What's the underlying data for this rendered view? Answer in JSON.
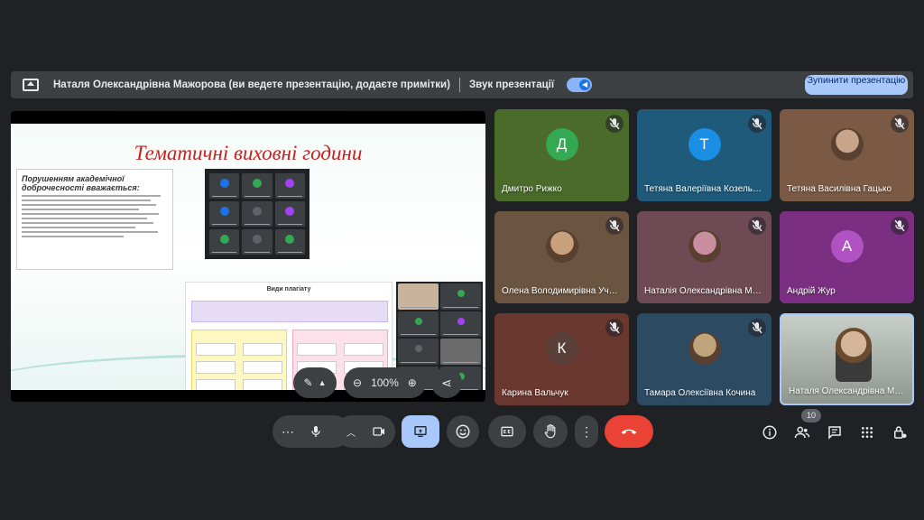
{
  "topbar": {
    "presenter_text": "Наталя Олександрівна Мажорова (ви ведете презентацію, додаєте примітки)",
    "sound_label": "Звук презентації",
    "stop_button": "Зупинити презентацію"
  },
  "slide": {
    "title": "Тематичні виховні години",
    "card_heading": "Порушенням академічної доброчесності вважається:",
    "plagiarism_title": "Види плагіату"
  },
  "zoom": {
    "level": "100%"
  },
  "participants": [
    {
      "name": "Дмитро Рижко",
      "initial": "Д",
      "bg": "#4a6b2a",
      "avatar_color": "#34a853",
      "muted": true
    },
    {
      "name": "Тетяна Валеріївна Козельс…",
      "initial": "Т",
      "bg": "#1f5a7a",
      "avatar_color": "#1a8fe3",
      "muted": true
    },
    {
      "name": "Тетяна Василівна Гацько",
      "initial": "",
      "bg": "#7a5a45",
      "avatar_color": "#c7a48a",
      "muted": true
    },
    {
      "name": "Олена Володимирівна Уча…",
      "initial": "",
      "bg": "#6b5540",
      "avatar_color": "#c9a27d",
      "muted": true
    },
    {
      "name": "Наталія Олександрівна Ма…",
      "initial": "",
      "bg": "#6e4a55",
      "avatar_color": "#c98ea0",
      "muted": true
    },
    {
      "name": "Андрій Жур",
      "initial": "А",
      "bg": "#7a2f82",
      "avatar_color": "#b152c2",
      "muted": true
    },
    {
      "name": "Карина Вальчук",
      "initial": "К",
      "bg": "#6b3830",
      "avatar_color": "#5a4038",
      "muted": true
    },
    {
      "name": "Тамара Олексіївна Кочина",
      "initial": "",
      "bg": "#2d4a63",
      "avatar_color": "#c0a47c",
      "muted": true
    },
    {
      "name": "Наталя Олександрівна Ма…",
      "initial": "",
      "bg": "#9aa39a",
      "avatar_color": "#d4b79a",
      "muted": false
    }
  ],
  "controls": {
    "more_dots": "⋯",
    "participants_count": "10"
  }
}
